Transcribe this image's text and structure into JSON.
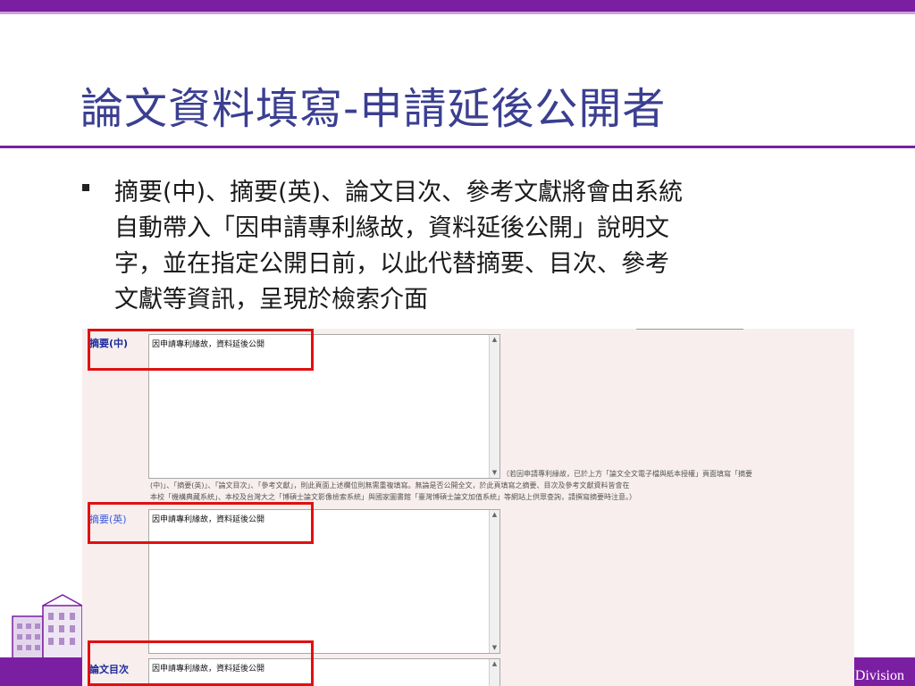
{
  "slide": {
    "title": "論文資料填寫-申請延後公開者",
    "body_lines": [
      "摘要(中)、摘要(英)、論文目次、參考文獻將會由系統",
      "自動帶入「因申請專利緣故，資料延後公開」說明文",
      "字，並在指定公開日前，以此代替摘要、目次、參考",
      "文獻等資訊，呈現於檢索介面"
    ],
    "footer": "Division"
  },
  "form": {
    "abstract_zh_label": "摘要(中)",
    "abstract_en_label": "摘要(英)",
    "toc_label": "論文目次",
    "auto_text": "因申請專利緣故，資料延後公開",
    "note_lines": [
      "（若因申請專利緣故，已於上方「論文全文電子檔與紙本授權」頁面填寫「摘要",
      "(中)」、「摘要(英)」、「論文目次」、「參考文獻」，則此頁面上述欄位則無需重複填寫。無論是否公開全文，於此頁填寫之摘要、目次及參考文獻資料皆會在",
      "本校「機構典藏系統」、本校及台灣大之「博碩士論文影像檢索系統」與國家圖書館「臺灣博碩士論文加值系統」等網站上供眾查詢，請撰寫摘要時注意。）"
    ]
  },
  "colors": {
    "accent": "#7b1fa2",
    "title": "#3b3f91",
    "highlight": "#e01010",
    "panel_bg": "#f8eeee"
  }
}
